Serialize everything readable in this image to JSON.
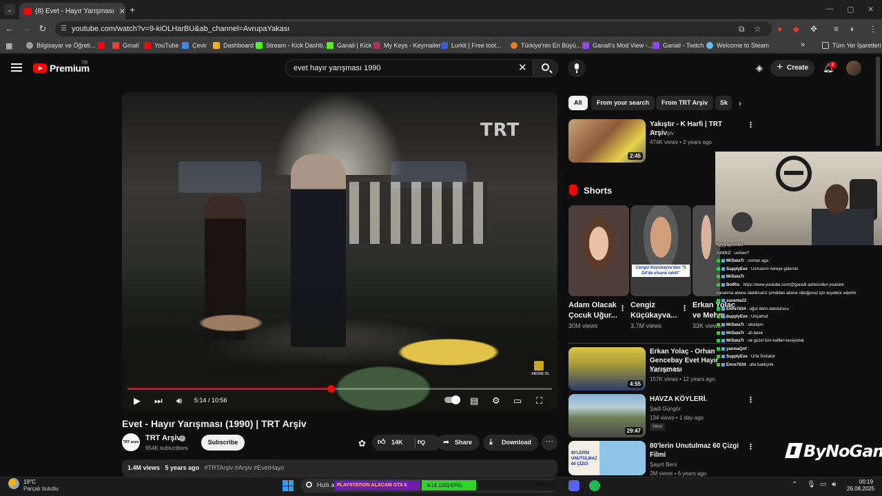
{
  "browser": {
    "tab_title": "(8) Evet - Hayır Yarışması (1990) | TRT Arşiv",
    "url": "youtube.com/watch?v=9-kiOLHarBU&ab_channel=AvrupaYakası",
    "bookmarks": [
      {
        "label": "Bilgisayar ve Öğreti...",
        "color": "#9aa0a6"
      },
      {
        "label": "",
        "color": "#ff0000"
      },
      {
        "label": "Gmail",
        "color": "#ea4335"
      },
      {
        "label": "YouTube",
        "color": "#ff0000"
      },
      {
        "label": "Çevir",
        "color": "#4285f4"
      },
      {
        "label": "Dashboard",
        "color": "#f4b400"
      },
      {
        "label": "Stream - Kick Dashb...",
        "color": "#53fc18"
      },
      {
        "label": "Ganali | Kick",
        "color": "#53fc18"
      },
      {
        "label": "My Keys - Keymailer",
        "color": "#b03060"
      },
      {
        "label": "Lurkit | Free tool...",
        "color": "#3b5bdb"
      },
      {
        "label": "Türkiye'nin En Büyü...",
        "color": "#e67e22"
      },
      {
        "label": "Ganali's Mod View -...",
        "color": "#9146ff"
      },
      {
        "label": "Ganali - Twitch",
        "color": "#9146ff"
      },
      {
        "label": "Welcome to Steam",
        "color": "#66c0f4"
      }
    ],
    "bookmarks_more": "»",
    "all_bookmarks": "Tüm Yer İşaretleri"
  },
  "header": {
    "logo_text": "Premium",
    "country_code": "TR",
    "search_query": "evet hayır yarışması 1990",
    "create_label": "Create",
    "notif_count": "8"
  },
  "player": {
    "watermark": "TRT",
    "subscribe_overlay": "ABONE OL",
    "time_display": "5:14 / 10:56",
    "progress": 0.4787
  },
  "video": {
    "title": "Evet - Hayır Yarışması (1990) | TRT Arşiv",
    "channel_name": "TRT Arşiv",
    "channel_avatar_text": "TRT arşiv",
    "verified_mark": "✓",
    "subscribers": "954K subscribers",
    "subscribe_label": "Subscribe",
    "likes": "14K",
    "share_label": "Share",
    "download_label": "Download",
    "views": "1.4M views",
    "age": "5 years ago",
    "hashtags": "#TRTArşiv #Arşiv #EvetHayır"
  },
  "chips": [
    "All",
    "From your search",
    "From TRT Arşiv",
    "Sk"
  ],
  "related_top": {
    "title": "Yakıştır - K Harfi | TRT Arşiv",
    "channel": "TRT Arşiv",
    "meta": "474K views • 2 years ago",
    "duration": "2:45"
  },
  "shorts": {
    "heading": "Shorts",
    "items": [
      {
        "title": "Adam Olacak Çocuk Uğur...",
        "views": "30M views"
      },
      {
        "title": "Cengiz Küçükayva...",
        "views": "3.7M views",
        "caption": "Cengiz Küçükayva'dan \"5 Dil'de efsane taklit\""
      },
      {
        "title": "Erkan Yolaç ve Mehm...",
        "views": "33K views"
      }
    ]
  },
  "related": [
    {
      "title": "Erkan Yolaç - Orhan Gencebay Evet Hayır Yarışması",
      "channel": "Kadınlar. Co",
      "meta": "157K views • 12 years ago",
      "duration": "4:55"
    },
    {
      "title": "HAVZA KÖYLERİ.",
      "channel": "Şadi Güngör",
      "meta": "134 views • 1 day ago",
      "duration": "29:47",
      "badge": "New"
    },
    {
      "title": "80'lerin Unutulmaz 60 Çizgi Filmi",
      "channel": "Şaşırt Beni",
      "meta": "2M views • 6 years ago",
      "thumb_text": "80'LERİN UNUTULMAZ 60 ÇİZGİ"
    }
  ],
  "chat": [
    {
      "user": "",
      "msg": "fiyjyjyajyocdvo"
    },
    {
      "user": "",
      "msg": "IsIMBIZ : usman?"
    },
    {
      "user": "MrDataTr",
      "msg": ": usman aga"
    },
    {
      "user": "SupplyExe",
      "msg": ": Usmanım nereye gidersin"
    },
    {
      "user": "MrDataTr",
      "msg": ":"
    },
    {
      "user": "BotRix",
      "msg": ": https://www.youtube.com/@ganalli adresinden youtube"
    },
    {
      "user": "",
      "msg": "kanalıma abone olabilirsiniz şimdiden abone olduğunuz için teşekkür ederim."
    },
    {
      "user": "savanta23",
      "msg": ":"
    },
    {
      "user": "Emre7634",
      "msg": ": uğur derin dondurucu"
    },
    {
      "user": "SupplyExe",
      "msg": ": Unçartsd"
    },
    {
      "user": "MrDataTr",
      "msg": ": ulukayın"
    },
    {
      "user": "MrDataTr",
      "msg": ": ah beee"
    },
    {
      "user": "MrDataTr",
      "msg": ": ne güzel tüm kafileri kesiyoduk"
    },
    {
      "user": "yanmaQnf",
      "msg": ":"
    },
    {
      "user": "SupplyExe",
      "msg": ": Urfa Smilator"
    },
    {
      "user": "Emre7634",
      "msg": ": ulta bakkçılık"
    }
  ],
  "overlay_brand": "ByNoGame",
  "taskbar": {
    "temperature": "19°C",
    "weather": "Parçalı bulutlu",
    "search_text": "Hızlı a",
    "ps_banner": "PLAYSTATION ALACAM GTA 6",
    "donation_current": "₺14.160(40%)",
    "donation_goal": "₺35.000",
    "donation_progress": 0.4,
    "time": "00:19",
    "date": "26.08.2025"
  }
}
